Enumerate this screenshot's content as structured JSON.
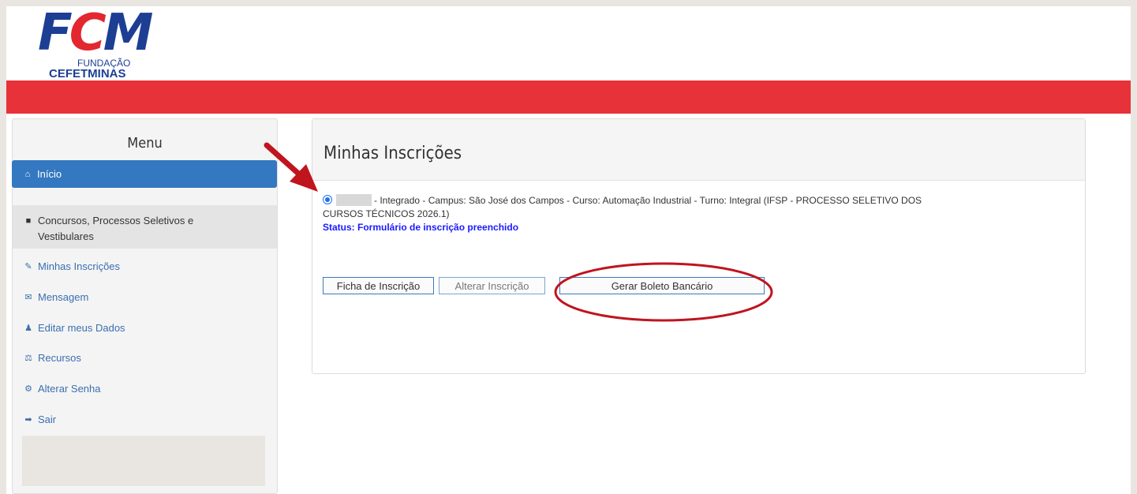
{
  "logo": {
    "main": "FCM",
    "main_c": "C",
    "line1": "FUNDAÇÃO",
    "line2": "CEFETMINAS"
  },
  "sidebar": {
    "title": "Menu",
    "items": [
      {
        "label": "Início",
        "icon": "home-icon",
        "glyph": "⌂"
      },
      {
        "label": "Concursos, Processos Seletivos e Vestibulares",
        "icon": "folder-icon",
        "glyph": "■"
      },
      {
        "label": "Minhas Inscrições",
        "icon": "edit-icon",
        "glyph": "✎"
      },
      {
        "label": "Mensagem",
        "icon": "envelope-icon",
        "glyph": "✉"
      },
      {
        "label": "Editar meus Dados",
        "icon": "user-icon",
        "glyph": "♟"
      },
      {
        "label": "Recursos",
        "icon": "balance-scale-icon",
        "glyph": "⚖"
      },
      {
        "label": "Alterar Senha",
        "icon": "gear-icon",
        "glyph": "⚙"
      },
      {
        "label": "Sair",
        "icon": "sign-out-icon",
        "glyph": "➡"
      }
    ]
  },
  "main": {
    "title": "Minhas Inscrições",
    "inscription": {
      "line1": "- Integrado - Campus: São José dos Campos - Curso: Automação Industrial - Turno: Integral (IFSP - PROCESSO SELETIVO DOS",
      "line2": "CURSOS TÉCNICOS 2026.1)",
      "status": "Status: Formulário de inscrição preenchido"
    },
    "buttons": {
      "ficha": "Ficha de Inscrição",
      "alterar": "Alterar Inscrição",
      "boleto": "Gerar Boleto Bancário"
    }
  },
  "colors": {
    "brand_red": "#e8323a",
    "brand_blue": "#1c3f94",
    "active_blue": "#3378c0",
    "annotation_red": "#c0141e"
  }
}
